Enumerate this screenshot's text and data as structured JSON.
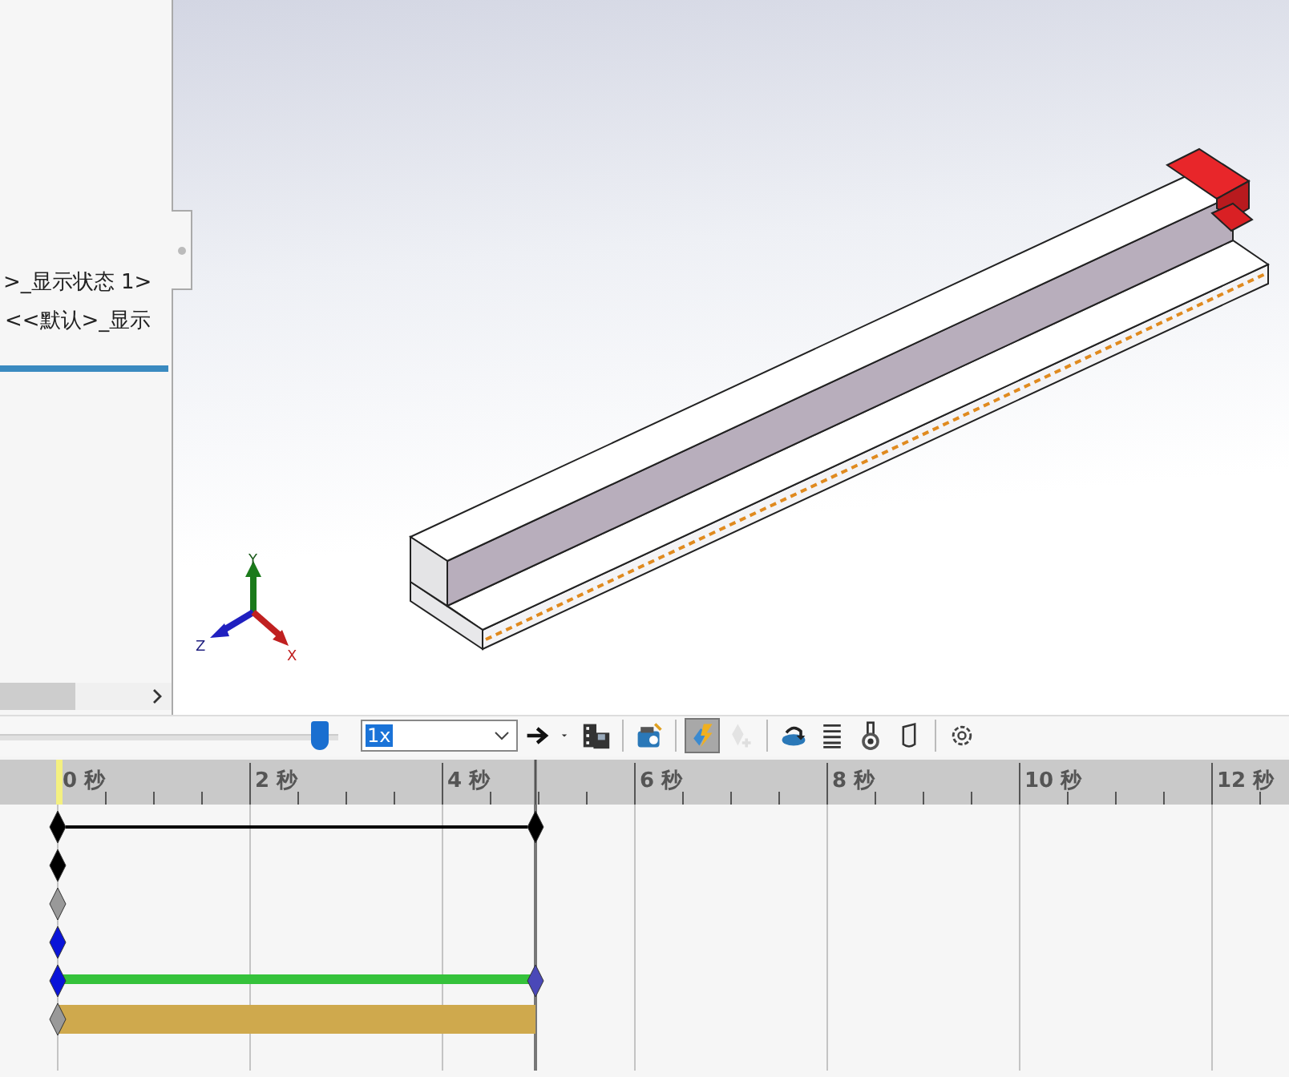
{
  "tree": {
    "items": [
      ">_显示状态 1>",
      "<<默认>_显示"
    ]
  },
  "triad": {
    "x": "X",
    "y": "Y",
    "z": "Z"
  },
  "toolbar": {
    "slider": {
      "level": 0.97
    },
    "speed": {
      "value": "1x"
    },
    "buttons": [
      {
        "kind": "play-arrow",
        "selected": false,
        "disabled": false
      },
      {
        "kind": "caret",
        "selected": false,
        "disabled": false
      },
      {
        "kind": "save-animation",
        "selected": false,
        "disabled": false
      },
      {
        "kind": "sep"
      },
      {
        "kind": "camera-view",
        "selected": false,
        "disabled": false
      },
      {
        "kind": "sep"
      },
      {
        "kind": "autokey",
        "selected": true,
        "disabled": false
      },
      {
        "kind": "add-key",
        "selected": false,
        "disabled": true
      },
      {
        "kind": "sep"
      },
      {
        "kind": "motor",
        "selected": false,
        "disabled": false
      },
      {
        "kind": "spring",
        "selected": false,
        "disabled": false
      },
      {
        "kind": "contact",
        "selected": false,
        "disabled": false
      },
      {
        "kind": "gravity",
        "selected": false,
        "disabled": false
      },
      {
        "kind": "sep"
      },
      {
        "kind": "settings",
        "selected": false,
        "disabled": false
      }
    ]
  },
  "ruler": {
    "labels": [
      "0 秒",
      "2 秒",
      "4 秒",
      "6 秒",
      "8 秒",
      "10 秒",
      "12 秒"
    ]
  },
  "tracks": [
    {
      "kind": "line",
      "color": "#000000",
      "keys": [
        {
          "color": "#000000"
        },
        {
          "color": "#000000"
        }
      ]
    },
    {
      "kind": "key",
      "keys": [
        {
          "color": "#000000"
        }
      ]
    },
    {
      "kind": "key",
      "keys": [
        {
          "color": "#999999"
        }
      ]
    },
    {
      "kind": "key",
      "keys": [
        {
          "color": "#0a14d8"
        }
      ]
    },
    {
      "kind": "bar",
      "color": "#35c23b",
      "keys": [
        {
          "color": "#0a14d8"
        },
        {
          "color": "#4a48b8"
        }
      ]
    },
    {
      "kind": "thick",
      "color": "#cfa94d",
      "keys": [
        {
          "color": "#999999"
        }
      ]
    }
  ]
}
